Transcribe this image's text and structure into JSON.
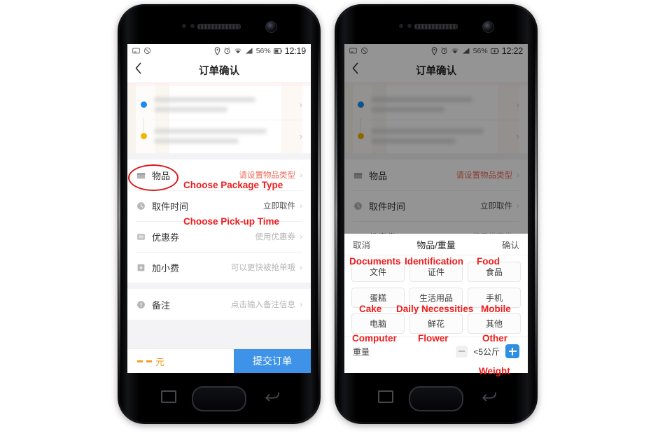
{
  "statusbar": {
    "left_icons": [
      "screenshot-icon",
      "no-sync-icon"
    ],
    "right_icons": [
      "location-icon",
      "alarm-icon",
      "wifi-icon",
      "signal-icon"
    ],
    "battery_percent": "56%",
    "time_left_phone": "12:19",
    "time_right_phone": "12:22"
  },
  "app": {
    "title": "订单确认",
    "back_icon": "back-chevron-icon"
  },
  "address": {
    "pickup_dot": "blue",
    "dropoff_dot": "amber",
    "redacted": true
  },
  "rows": [
    {
      "label": "物品",
      "value": "请设置物品类型",
      "icon": "package-icon",
      "warn": true
    },
    {
      "label": "取件时间",
      "value": "立即取件",
      "icon": "clock-icon",
      "warn": false
    },
    {
      "label": "优惠券",
      "value": "使用优惠券",
      "icon": "coupon-icon",
      "warn": false
    },
    {
      "label": "加小费",
      "value": "可以更快被抢单哦",
      "icon": "tip-icon",
      "warn": false
    },
    {
      "label": "备注",
      "value": "点击输入备注信息",
      "icon": "info-icon",
      "warn": false
    }
  ],
  "bottombar": {
    "price": "元",
    "price_placeholder": "--",
    "submit_label": "提交订单",
    "submit_color": "#3e93e8"
  },
  "sheet": {
    "cancel_label": "取消",
    "title": "物品/重量",
    "confirm_label": "确认",
    "categories": [
      {
        "zh": "文件",
        "en": "Documents"
      },
      {
        "zh": "证件",
        "en": "Identification"
      },
      {
        "zh": "食品",
        "en": "Food"
      },
      {
        "zh": "蛋糕",
        "en": "Cake"
      },
      {
        "zh": "生活用品",
        "en": "Daily Necessities"
      },
      {
        "zh": "手机",
        "en": "Mobile"
      },
      {
        "zh": "电脑",
        "en": "Computer"
      },
      {
        "zh": "鲜花",
        "en": "Flower"
      },
      {
        "zh": "其他",
        "en": "Other"
      }
    ],
    "weight": {
      "label": "重量",
      "value": "<5公斤",
      "en": "Weight",
      "minus_icon": "minus-icon",
      "plus_icon": "plus-icon",
      "plus_color": "#2f8fe0"
    }
  },
  "annotations": {
    "color": "#ee1c1c",
    "choose_package_type": "Choose Package Type",
    "choose_pickup_time": "Choose Pick-up Time",
    "ellipse_target": "物品"
  },
  "hardware": {
    "nav_recents": "recents-icon",
    "nav_home": "home-button",
    "nav_back": "back-icon",
    "camera": "front-camera",
    "speaker": "earpiece-speaker"
  }
}
